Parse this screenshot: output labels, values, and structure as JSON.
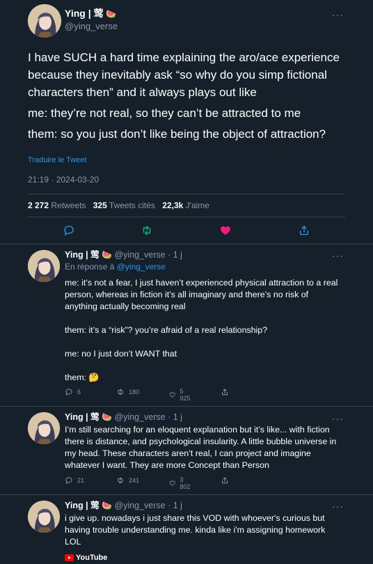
{
  "main_tweet": {
    "author_name": "Ying | 莺",
    "author_emoji": "🍉",
    "handle": "@ying_verse",
    "more_label": "···",
    "paragraphs": [
      "I have SUCH a hard time explaining the aro/ace experience because they inevitably ask “so why do you simp fictional characters then” and it always plays out like",
      "me: they’re not real, so they can’t be attracted to me",
      "them: so you just don’t like being the object of attraction?"
    ],
    "translate_label": "Traduire le Tweet",
    "timestamp": "21:19 · 2024-03-20",
    "stats": {
      "retweets_count": "2 272",
      "retweets_label": "Retweets",
      "quotes_count": "325",
      "quotes_label": "Tweets cités",
      "likes_count": "22,3k",
      "likes_label": "J'aime"
    }
  },
  "replies": [
    {
      "author_name": "Ying | 莺",
      "author_emoji": "🍉",
      "meta": "@ying_verse · 1 j",
      "reply_prefix": "En réponse à",
      "reply_to": "@ying_verse",
      "paragraphs": [
        "me: it’s not a fear, I just haven’t experienced physical attraction to a real person, whereas in fiction it’s all imaginary and there’s no risk of anything actually becoming real",
        "them: it’s a “risk”? you’re afraid of a real relationship?",
        "me: no I just don’t WANT that",
        "them: 🤔"
      ],
      "replies_count": "6",
      "retweets_count": "180",
      "likes_count": "5 925"
    },
    {
      "author_name": "Ying | 莺",
      "author_emoji": "🍉",
      "meta": "@ying_verse · 1 j",
      "paragraphs": [
        "I’m still searching for an eloquent explanation but it’s like... with fiction there is distance, and psychological insularity. A little bubble universe in my head. These characters aren’t real, I can project and imagine whatever I want. They are more Concept than Person"
      ],
      "replies_count": "21",
      "retweets_count": "241",
      "likes_count": "3 802"
    },
    {
      "author_name": "Ying | 莺",
      "author_emoji": "🍉",
      "meta": "@ying_verse · 1 j",
      "paragraphs": [
        "i give up. nowadays i just share this VOD with whoever's curious but having trouble understanding me. kinda like i'm assigning homework LOL"
      ],
      "link_card_label": "YouTube"
    }
  ],
  "colors": {
    "background": "#15202b",
    "accent": "#1d9bf0",
    "secondary_text": "#8b98a5",
    "retweet_green": "#00ba7c",
    "like_pink": "#f91880"
  }
}
